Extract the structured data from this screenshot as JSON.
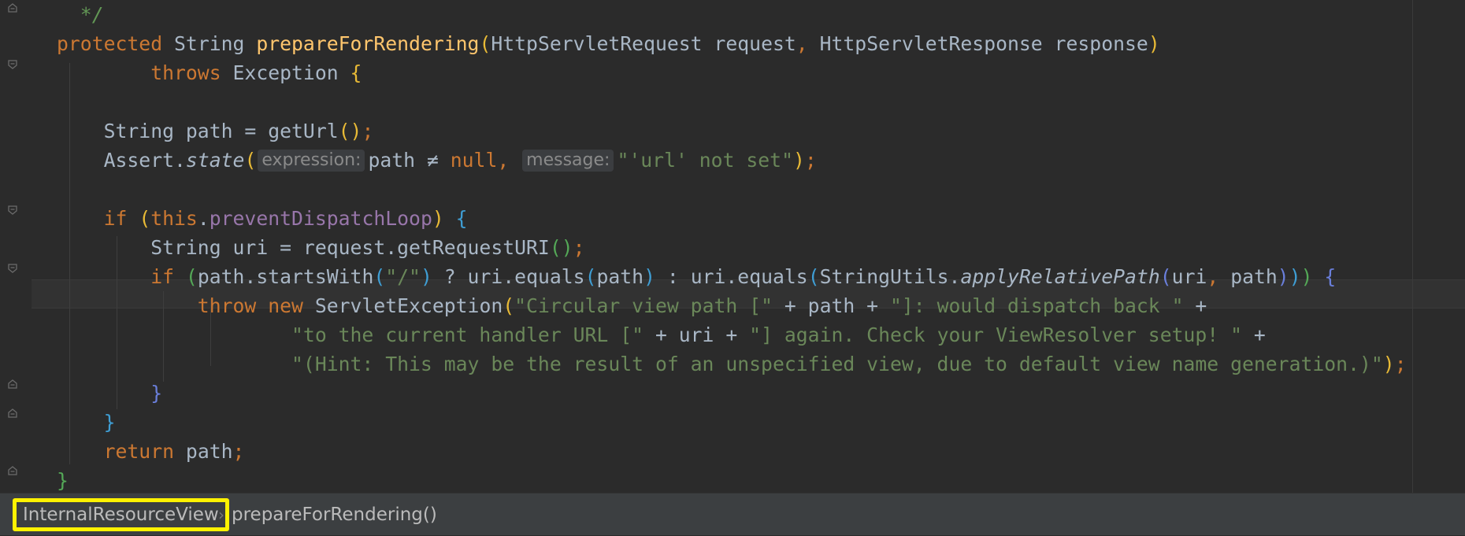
{
  "editor": {
    "lines": [
      [
        {
          "t": "  */",
          "c": "cm"
        }
      ],
      [
        {
          "t": "protected ",
          "c": "kw"
        },
        {
          "t": "String ",
          "c": ""
        },
        {
          "t": "prepareForRendering",
          "c": "fn"
        },
        {
          "t": "(",
          "c": "p1"
        },
        {
          "t": "HttpServletRequest request",
          "c": ""
        },
        {
          "t": ", ",
          "c": "kw"
        },
        {
          "t": "HttpServletResponse response",
          "c": ""
        },
        {
          "t": ")",
          "c": "p1"
        }
      ],
      [
        {
          "t": "        throws ",
          "c": "kw"
        },
        {
          "t": "Exception ",
          "c": ""
        },
        {
          "t": "{",
          "c": "p1"
        }
      ],
      [],
      [
        {
          "t": "    String path = getUrl",
          "c": ""
        },
        {
          "t": "()",
          "c": "p1"
        },
        {
          "t": ";",
          "c": "kw"
        }
      ],
      [
        {
          "t": "    Assert.",
          "c": ""
        },
        {
          "t": "state",
          "c": "it"
        },
        {
          "t": "(",
          "c": "p1"
        },
        {
          "t": "expression:",
          "c": "hint"
        },
        {
          "t": "path ≠ ",
          "c": ""
        },
        {
          "t": "null",
          "c": "kw"
        },
        {
          "t": ", ",
          "c": "kw"
        },
        {
          "t": "message:",
          "c": "hint"
        },
        {
          "t": "\"'url' not set\"",
          "c": "st"
        },
        {
          "t": ")",
          "c": "p1"
        },
        {
          "t": ";",
          "c": "kw"
        }
      ],
      [],
      [
        {
          "t": "    if ",
          "c": "kw"
        },
        {
          "t": "(",
          "c": "p1"
        },
        {
          "t": "this",
          "c": "kw"
        },
        {
          "t": ".",
          "c": ""
        },
        {
          "t": "preventDispatchLoop",
          "c": "fld"
        },
        {
          "t": ") ",
          "c": "p1"
        },
        {
          "t": "{",
          "c": "p2"
        }
      ],
      [
        {
          "t": "        String uri = request.getRequestURI",
          "c": ""
        },
        {
          "t": "()",
          "c": "p3"
        },
        {
          "t": ";",
          "c": "kw"
        }
      ],
      [
        {
          "t": "        if ",
          "c": "kw"
        },
        {
          "t": "(",
          "c": "p3"
        },
        {
          "t": "path.startsWith",
          "c": ""
        },
        {
          "t": "(",
          "c": "p2"
        },
        {
          "t": "\"/\"",
          "c": "st"
        },
        {
          "t": ")",
          "c": "p2"
        },
        {
          "t": " ? uri.equals",
          "c": ""
        },
        {
          "t": "(",
          "c": "p2"
        },
        {
          "t": "path",
          "c": ""
        },
        {
          "t": ")",
          "c": "p2"
        },
        {
          "t": " : uri.equals",
          "c": ""
        },
        {
          "t": "(",
          "c": "p2"
        },
        {
          "t": "StringUtils.",
          "c": ""
        },
        {
          "t": "applyRelativePath",
          "c": "it"
        },
        {
          "t": "(",
          "c": "p4"
        },
        {
          "t": "uri",
          "c": ""
        },
        {
          "t": ", ",
          "c": "kw"
        },
        {
          "t": "path",
          "c": ""
        },
        {
          "t": ")",
          "c": "p4"
        },
        {
          "t": ")",
          "c": "p2"
        },
        {
          "t": ") ",
          "c": "p3"
        },
        {
          "t": "{",
          "c": "p4"
        }
      ],
      [
        {
          "t": "            throw new ",
          "c": "kw"
        },
        {
          "t": "ServletException",
          "c": ""
        },
        {
          "t": "(",
          "c": "p1"
        },
        {
          "t": "\"Circular view path [\" ",
          "c": "st"
        },
        {
          "t": "+ path + ",
          "c": ""
        },
        {
          "t": "\"]: would dispatch back \" ",
          "c": "st"
        },
        {
          "t": "+",
          "c": ""
        }
      ],
      [
        {
          "t": "                    \"to the current handler URL [\" ",
          "c": "st"
        },
        {
          "t": "+ uri + ",
          "c": ""
        },
        {
          "t": "\"] again. Check your ViewResolver setup! \" ",
          "c": "st"
        },
        {
          "t": "+",
          "c": ""
        }
      ],
      [
        {
          "t": "                    \"(Hint: This may be the result of an unspecified view, due to default view name generation.)\"",
          "c": "st"
        },
        {
          "t": ")",
          "c": "p1"
        },
        {
          "t": ";",
          "c": "kw"
        }
      ],
      [
        {
          "t": "        }",
          "c": "p4"
        }
      ],
      [
        {
          "t": "    }",
          "c": "p2"
        }
      ],
      [
        {
          "t": "    return ",
          "c": "kw"
        },
        {
          "t": "path",
          "c": ""
        },
        {
          "t": ";",
          "c": "kw"
        }
      ],
      [
        {
          "t": "}",
          "c": "p3"
        }
      ]
    ]
  },
  "breadcrumb": {
    "class_name": "InternalResourceView",
    "separator": "›",
    "method_name": "prepareForRendering()"
  },
  "colors": {
    "background": "#2b2b2b",
    "keyword": "#cc7832",
    "method_decl": "#ffc66d",
    "string": "#6a8759",
    "field": "#9876aa",
    "highlight_box": "#fff200"
  }
}
